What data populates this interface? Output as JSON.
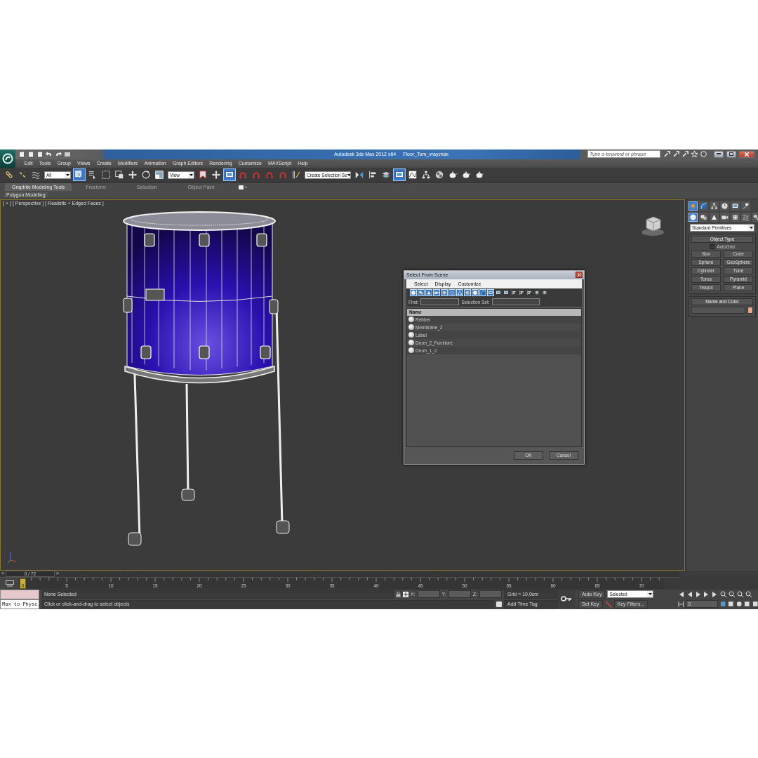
{
  "title_bar": {
    "app_title": "Autodesk 3ds Max  2012 x64",
    "file_name": "Floor_Tom_vray.max",
    "search": {
      "placeholder": "Type a keyword or phrase"
    }
  },
  "menu_bar": [
    "Edit",
    "Tools",
    "Group",
    "Views",
    "Create",
    "Modifiers",
    "Animation",
    "Graph Editors",
    "Rendering",
    "Customize",
    "MAXScript",
    "Help"
  ],
  "main_toolbar": [
    {
      "kind": "link",
      "selected": false
    },
    {
      "kind": "unlink",
      "selected": false
    },
    {
      "kind": "bind",
      "selected": false
    },
    {
      "kind": "dropdown",
      "value": "All"
    },
    {
      "kind": "select",
      "selected": true
    },
    {
      "kind": "select-name",
      "selected": false
    },
    {
      "kind": "region",
      "selected": false
    },
    {
      "kind": "window",
      "selected": false
    },
    {
      "kind": "move",
      "selected": false
    },
    {
      "kind": "rotate",
      "selected": false
    },
    {
      "kind": "scale",
      "selected": false
    },
    {
      "kind": "dropdown",
      "value": "View"
    },
    {
      "kind": "pivot",
      "selected": false
    },
    {
      "kind": "manipulate",
      "selected": false
    },
    {
      "kind": "keyboard",
      "selected": true
    },
    {
      "kind": "snap",
      "selected": false
    },
    {
      "kind": "angle",
      "selected": false
    },
    {
      "kind": "percent",
      "selected": false
    },
    {
      "kind": "spinner",
      "selected": false
    },
    {
      "kind": "edit-sel",
      "selected": false
    },
    {
      "kind": "dropdown",
      "value": "Create Selection Se"
    },
    {
      "kind": "mirror",
      "selected": false
    },
    {
      "kind": "align",
      "selected": false
    },
    {
      "kind": "layers",
      "selected": false
    },
    {
      "kind": "explorer",
      "selected": true
    },
    {
      "kind": "curve",
      "selected": false
    },
    {
      "kind": "schematic",
      "selected": false
    },
    {
      "kind": "material",
      "selected": false
    },
    {
      "kind": "render-setup",
      "selected": false
    },
    {
      "kind": "render-frame",
      "selected": false
    },
    {
      "kind": "render",
      "selected": false
    }
  ],
  "ribbon": {
    "tabs": [
      {
        "label": "Graphite Modeling Tools",
        "selected": true
      },
      {
        "label": "Freeform",
        "selected": false
      },
      {
        "label": "Selection",
        "selected": false
      },
      {
        "label": "Object Paint",
        "selected": false
      }
    ],
    "panel": "Polygon Modeling"
  },
  "viewport": {
    "labels": [
      "[ + ]",
      "[ Perspective ]",
      "[ Realistic + Edged Faces ]"
    ]
  },
  "dialog": {
    "title": "Select From Scene",
    "menu": [
      "Select",
      "Display",
      "Customize"
    ],
    "filters": [
      {
        "selected": true
      },
      {
        "selected": true
      },
      {
        "selected": true
      },
      {
        "selected": true
      },
      {
        "selected": true
      },
      {
        "selected": true
      },
      {
        "selected": true
      },
      {
        "selected": true
      },
      {
        "selected": true
      },
      {
        "selected": true
      },
      {
        "selected": true
      },
      {
        "selected": false
      },
      {
        "selected": false
      },
      {
        "selected": false
      },
      {
        "selected": false
      },
      {
        "selected": false
      },
      {
        "selected": false
      },
      {
        "selected": false
      }
    ],
    "find_label": "Find:",
    "selection_set_label": "Selection Set:",
    "column": "Name",
    "rows": [
      {
        "name": "Rebber",
        "selected": false
      },
      {
        "name": "Membrane_2",
        "selected": false
      },
      {
        "name": "Label",
        "selected": false
      },
      {
        "name": "Drum_2_Furniture",
        "selected": false
      },
      {
        "name": "Drum_1_2",
        "selected": false
      }
    ],
    "buttons": [
      "OK",
      "Cancel"
    ]
  },
  "command_panel": {
    "tabs": [
      {
        "kind": "create",
        "selected": true
      },
      {
        "kind": "modify",
        "selected": false
      },
      {
        "kind": "hierarchy",
        "selected": false
      },
      {
        "kind": "motion",
        "selected": false
      },
      {
        "kind": "display",
        "selected": false
      },
      {
        "kind": "utilities",
        "selected": false
      }
    ],
    "categories": [
      {
        "kind": "geometry",
        "selected": true
      },
      {
        "kind": "shapes",
        "selected": false
      },
      {
        "kind": "lights",
        "selected": false
      },
      {
        "kind": "cameras",
        "selected": false
      },
      {
        "kind": "helpers",
        "selected": false
      },
      {
        "kind": "spacewarps",
        "selected": false
      },
      {
        "kind": "systems",
        "selected": false
      }
    ],
    "dropdown": "Standard Primitives",
    "object_type": {
      "title": "Object Type",
      "autogrid": {
        "label": "AutoGrid",
        "checked": false
      },
      "buttons": [
        "Box",
        "Cone",
        "Sphere",
        "GeoSphere",
        "Cylinder",
        "Tube",
        "Torus",
        "Pyramid",
        "Teapot",
        "Plane"
      ]
    },
    "name_and_color": {
      "title": "Name and Color",
      "color": "#e8a98a"
    }
  },
  "time_slider": {
    "prev": "<",
    "position": "0 / 72",
    "level": 0,
    "next": ">"
  },
  "track_bar": {
    "current": "0",
    "labels": [
      "5",
      "10",
      "15",
      "20",
      "25",
      "30",
      "35",
      "40",
      "45",
      "50",
      "55",
      "60",
      "65",
      "70"
    ]
  },
  "status_bar": {
    "script_listener": "Max to Physc.",
    "selection": "None Selected",
    "prompt": "Click or click-and-drag to select objects",
    "coords": [
      "X:",
      "Y:",
      "Z:"
    ],
    "grid": "Grid = 10,0cm",
    "time_tag": "Add Time Tag",
    "auto_key": "Auto Key",
    "key_mode": "Selected",
    "set_key": "Set Key",
    "key_filters": "Key Filters...",
    "frame": "0"
  }
}
